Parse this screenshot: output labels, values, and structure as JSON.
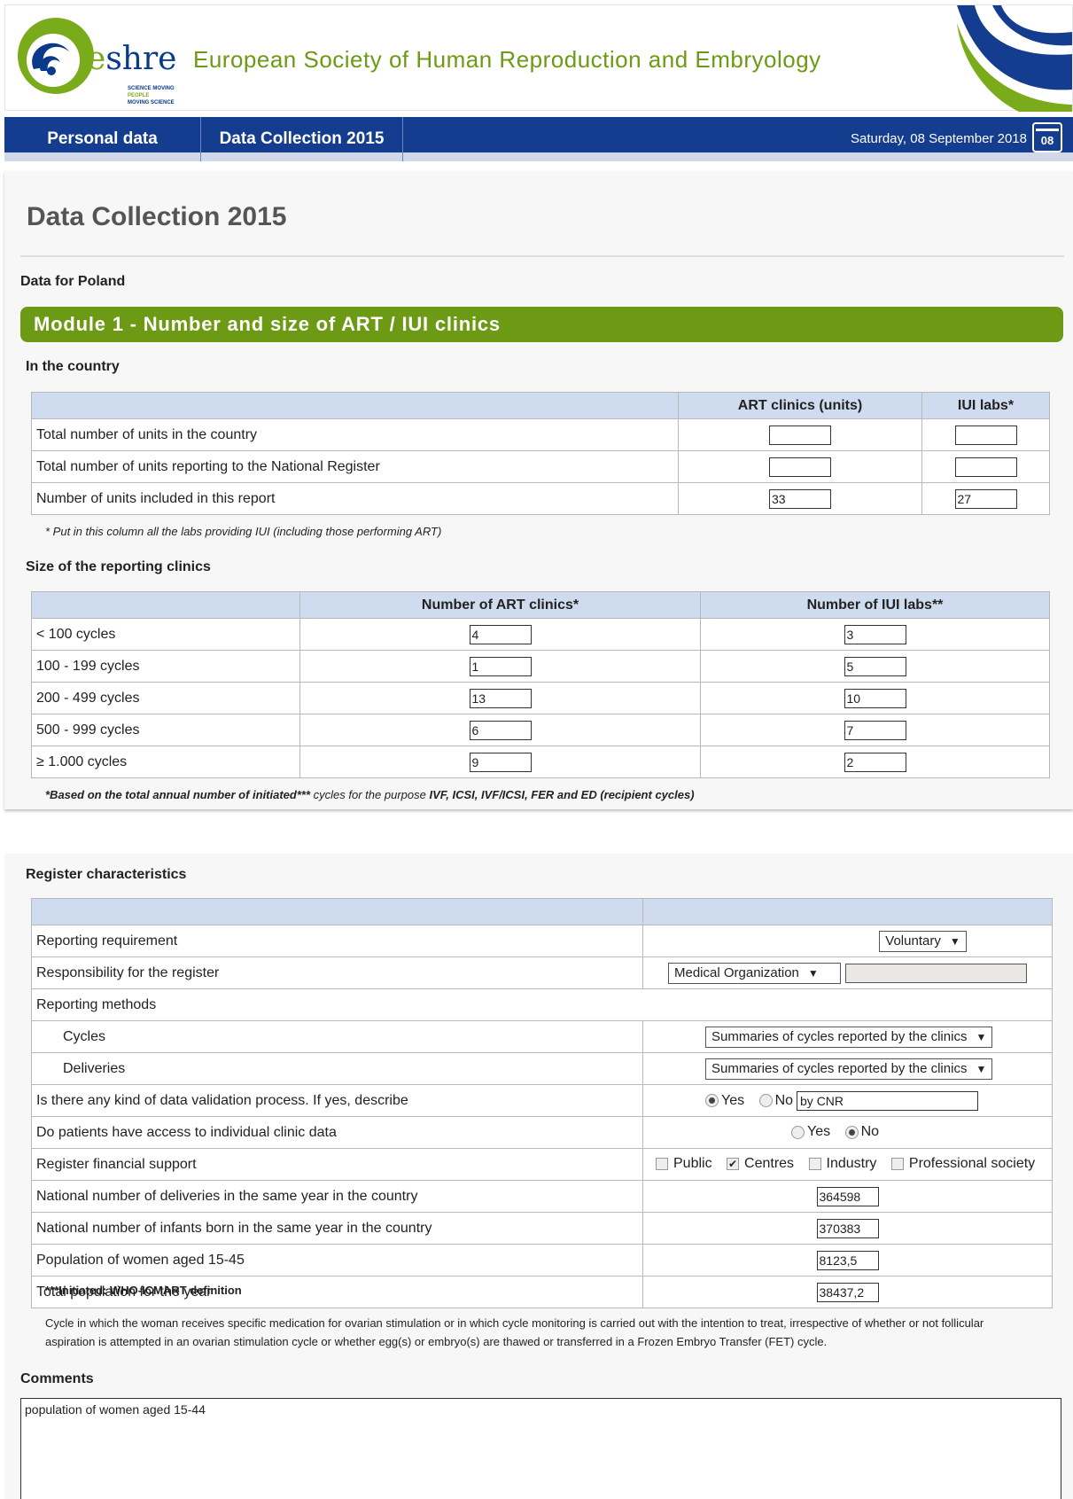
{
  "header": {
    "logo_text": "shre",
    "logo_letter": "e",
    "logo_taglines": [
      "SCIENCE MOVING",
      "PEOPLE",
      "MOVING SCIENCE"
    ],
    "title": "European Society of Human Reproduction and Embryology"
  },
  "nav": {
    "tabs": [
      "Personal data",
      "Data Collection 2015"
    ],
    "date": "Saturday, 08 September 2018",
    "calendar_day": "08"
  },
  "page": {
    "title": "Data Collection 2015",
    "country_label": "Data for Poland"
  },
  "module": {
    "title": "Module 1 - Number and size of ART / IUI clinics",
    "in_country": {
      "label": "In the country",
      "headers": [
        "ART clinics (units)",
        "IUI labs*"
      ],
      "rows": [
        {
          "label": "Total number of units in the country",
          "art": "",
          "iui": ""
        },
        {
          "label": "Total number of units reporting to the National Register",
          "art": "",
          "iui": ""
        },
        {
          "label": "Number of units included in this report",
          "art": "33",
          "iui": "27"
        }
      ],
      "footnote": "* Put in this column all the labs providing IUI (including those performing ART)"
    },
    "size": {
      "label": "Size of the reporting clinics",
      "headers": [
        "Number of ART clinics*",
        "Number of IUI labs**"
      ],
      "rows": [
        {
          "label": "< 100 cycles",
          "art": "4",
          "iui": "3"
        },
        {
          "label": "100 - 199 cycles",
          "art": "1",
          "iui": "5"
        },
        {
          "label": "200 - 499 cycles",
          "art": "13",
          "iui": "10"
        },
        {
          "label": "500 - 999 cycles",
          "art": "6",
          "iui": "7"
        },
        {
          "label": "≥ 1.000 cycles",
          "art": "9",
          "iui": "2"
        }
      ],
      "footnote_bold1": "*Based on the total annual number of initiated***",
      "footnote_mid": " cycles for the purpose ",
      "footnote_bold2": "IVF, ICSI, IVF/ICSI, FER and ED (recipient cycles)"
    }
  },
  "register": {
    "label": "Register characteristics",
    "reporting_requirement": {
      "label": "Reporting requirement",
      "value": "Voluntary"
    },
    "responsibility": {
      "label": "Responsibility for the register",
      "value": "Medical Organization"
    },
    "reporting_methods": {
      "label": "Reporting methods"
    },
    "cycles": {
      "label": "Cycles",
      "value": "Summaries of cycles reported by the clinics"
    },
    "deliveries": {
      "label": "Deliveries",
      "value": "Summaries of cycles reported by the clinics"
    },
    "validation": {
      "label": "Is there any kind of data validation process. If yes, describe",
      "yes": "Yes",
      "no": "No",
      "selected": "Yes",
      "description": "by CNR"
    },
    "access": {
      "label": "Do patients have access to individual clinic data",
      "yes": "Yes",
      "no": "No",
      "selected": "No"
    },
    "financial": {
      "label": "Register financial support",
      "options": [
        {
          "label": "Public",
          "checked": false
        },
        {
          "label": "Centres",
          "checked": true
        },
        {
          "label": "Industry",
          "checked": false
        },
        {
          "label": "Professional society",
          "checked": false
        }
      ]
    },
    "numbers": [
      {
        "label": "National number of deliveries in the same year in the country",
        "value": "364598"
      },
      {
        "label": "National number of infants born in the same year in the country",
        "value": "370383"
      },
      {
        "label": "Population of women aged 15-45",
        "value": "8123,5"
      },
      {
        "label": "Total population for the year",
        "value": "38437,2"
      }
    ]
  },
  "definition": {
    "title": "***Initiated: WHO-ICMART definition",
    "text": "Cycle in which the woman receives specific medication for ovarian stimulation or in which cycle monitoring is carried out with the intention to treat, irrespective of whether or not follicular aspiration is attempted in an ovarian stimulation cycle or whether egg(s) or embryo(s) are thawed or transferred in a Frozen Embryo Transfer (FET) cycle."
  },
  "comments": {
    "label": "Comments",
    "value": "population of women aged 15-44"
  },
  "colors": {
    "nav_blue": "#143d8f",
    "module_green": "#6d9a14",
    "table_header": "#cfdbef"
  }
}
